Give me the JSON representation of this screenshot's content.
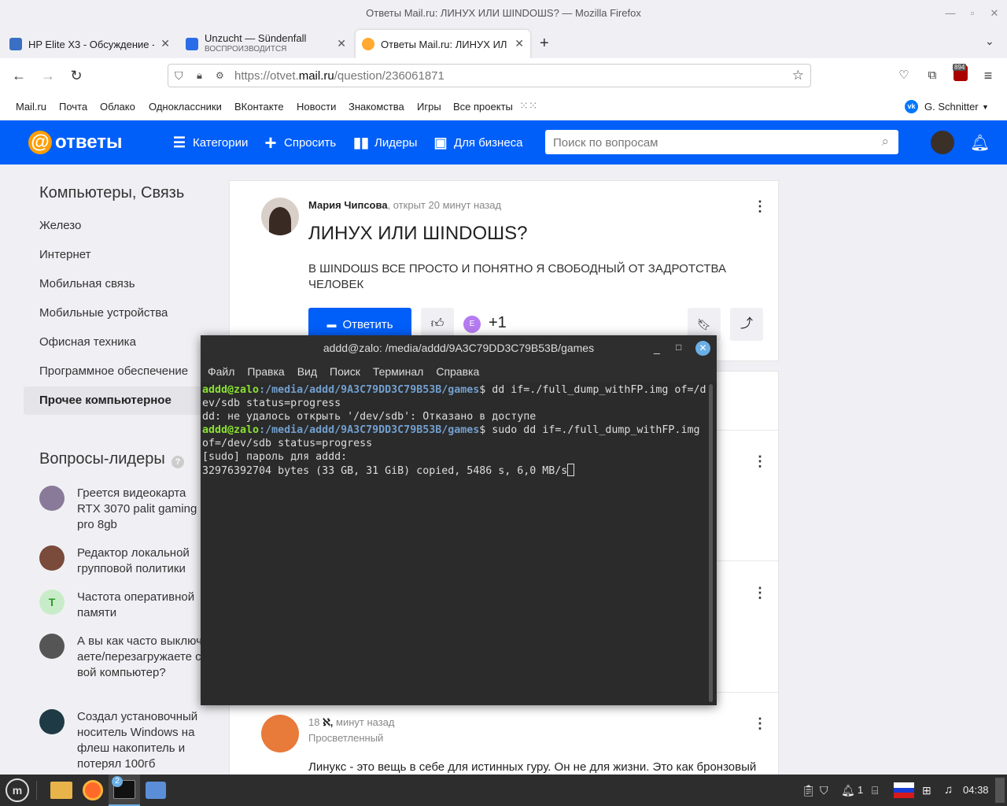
{
  "window": {
    "title": "Ответы Mail.ru: ЛИНУХ ИЛИ ШINDOШS? — Mozilla Firefox"
  },
  "tabs": [
    {
      "label": "HP Elite X3 - Обсуждение -",
      "sub": ""
    },
    {
      "label": "Unzucht — Sündenfall",
      "sub": "ВОСПРОИЗВОДИТСЯ"
    },
    {
      "label": "Ответы Mail.ru: ЛИНУХ ИЛ",
      "sub": ""
    }
  ],
  "url": {
    "prefix": "https://otvet.",
    "domain": "mail.ru",
    "path": "/question/236061871"
  },
  "extension_badge": "894",
  "portal": {
    "links": [
      "Mail.ru",
      "Почта",
      "Облако",
      "Одноклассники",
      "ВКонтакте",
      "Новости",
      "Знакомства",
      "Игры",
      "Все проекты"
    ],
    "user": "G. Schnitter"
  },
  "header": {
    "logo": "ответы",
    "nav": [
      "Категории",
      "Спросить",
      "Лидеры",
      "Для бизнеса"
    ],
    "search_placeholder": "Поиск по вопросам"
  },
  "sidebar": {
    "title": "Компьютеры, Связь",
    "items": [
      "Железо",
      "Интернет",
      "Мобильная связь",
      "Мобильные устройства",
      "Офисная техника",
      "Программное обеспечение",
      "Прочее компьютерное"
    ],
    "leaders_title": "Вопросы-лидеры",
    "leaders": [
      {
        "text": "Греется видеокарта RTX 3070 palit gaming pro 8gb",
        "color": "#8a7a9a"
      },
      {
        "text": "Редактор локальной групповой политики",
        "color": "#7a4a3a"
      },
      {
        "text": "Частота оперативной памяти",
        "color": "#c8ecc8",
        "letter": "T"
      },
      {
        "text": "А вы как часто выключаете/перезагружаете свой компьютер?",
        "color": "#555555"
      },
      {
        "text": "Создал установочный носитель Windows на флеш накопитель и потерял 100гб",
        "color": "#1e3a44"
      }
    ]
  },
  "question": {
    "author": "Мария Чипсова",
    "meta": ", открыт 20 минут назад",
    "title": "ЛИНУХ ИЛИ ШINDOШS?",
    "body": "В ШINDOШS ВСЕ ПРОСТО И ПОНЯТНО Я СВОБОДНЫЙ ОТ ЗАДРОТСТВА ЧЕЛОВЕК",
    "answer_button": "Ответить",
    "avatar_letter": "E",
    "plus": "+1"
  },
  "answer": {
    "meta_a": "18",
    "meta_b": "ℵ,",
    "meta_c": " минут назад",
    "rank": "Просветленный",
    "text": "Линукс - это вещь в себе для истинных гуру. Он не для жизни. Это как бронзовый"
  },
  "terminal": {
    "title": "addd@zalo: /media/addd/9A3C79DD3C79B53B/games",
    "menu": [
      "Файл",
      "Правка",
      "Вид",
      "Поиск",
      "Терминал",
      "Справка"
    ],
    "prompt_user": "addd@zalo",
    "prompt_path": ":/media/addd/9A3C79DD3C79B53B/games",
    "cmd1": "$ dd if=./full_dump_withFP.img of=/d",
    "cmd1b": "ev/sdb status=progress",
    "out1": "dd: не удалось открыть '/dev/sdb': Отказано в доступе",
    "cmd2": "$ sudo dd if=./full_dump_withFP.img",
    "cmd2b": "of=/dev/sdb status=progress",
    "out2": "[sudo] пароль для addd:",
    "out3": "32976392704 bytes (33 GB, 31 GiB) copied, 5486 s, 6,0 MB/s"
  },
  "taskbar": {
    "badge": "2",
    "notif_count": "1",
    "clock": "04:38"
  }
}
